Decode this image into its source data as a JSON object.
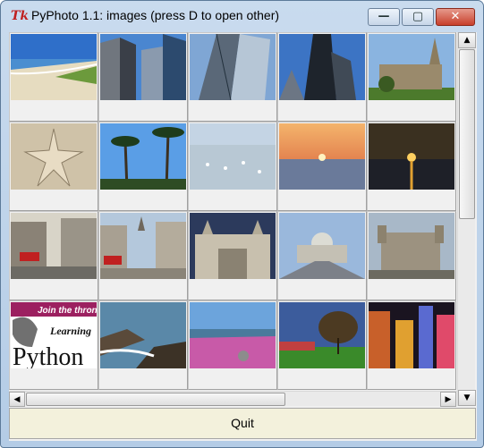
{
  "window": {
    "title": "PyPhoto 1.1: images  (press D to open other)",
    "app_icon_glyph": "Tk",
    "minimize_glyph": "—",
    "maximize_glyph": "▢",
    "close_glyph": "✕"
  },
  "thumbnails": [
    {
      "name": "beach-dunes"
    },
    {
      "name": "skyscrapers-1"
    },
    {
      "name": "glass-tower"
    },
    {
      "name": "sears-tower"
    },
    {
      "name": "cathedral"
    },
    {
      "name": "starfish"
    },
    {
      "name": "palm-trees"
    },
    {
      "name": "seagulls-shore"
    },
    {
      "name": "sunset-sea"
    },
    {
      "name": "sunset-gold"
    },
    {
      "name": "london-street"
    },
    {
      "name": "london-square"
    },
    {
      "name": "st-pauls-facade"
    },
    {
      "name": "millennium-bridge"
    },
    {
      "name": "tower-of-london"
    },
    {
      "name": "learning-python-cover",
      "text_top": "Join the throng!",
      "text_mid": "Learning",
      "text_big": "Python"
    },
    {
      "name": "rocky-coast"
    },
    {
      "name": "pink-shore"
    },
    {
      "name": "park-trees"
    },
    {
      "name": "city-night"
    }
  ],
  "scrollbars": {
    "up_arrow": "▲",
    "down_arrow": "▼",
    "left_arrow": "◀",
    "right_arrow": "▶"
  },
  "quit_label": "Quit"
}
